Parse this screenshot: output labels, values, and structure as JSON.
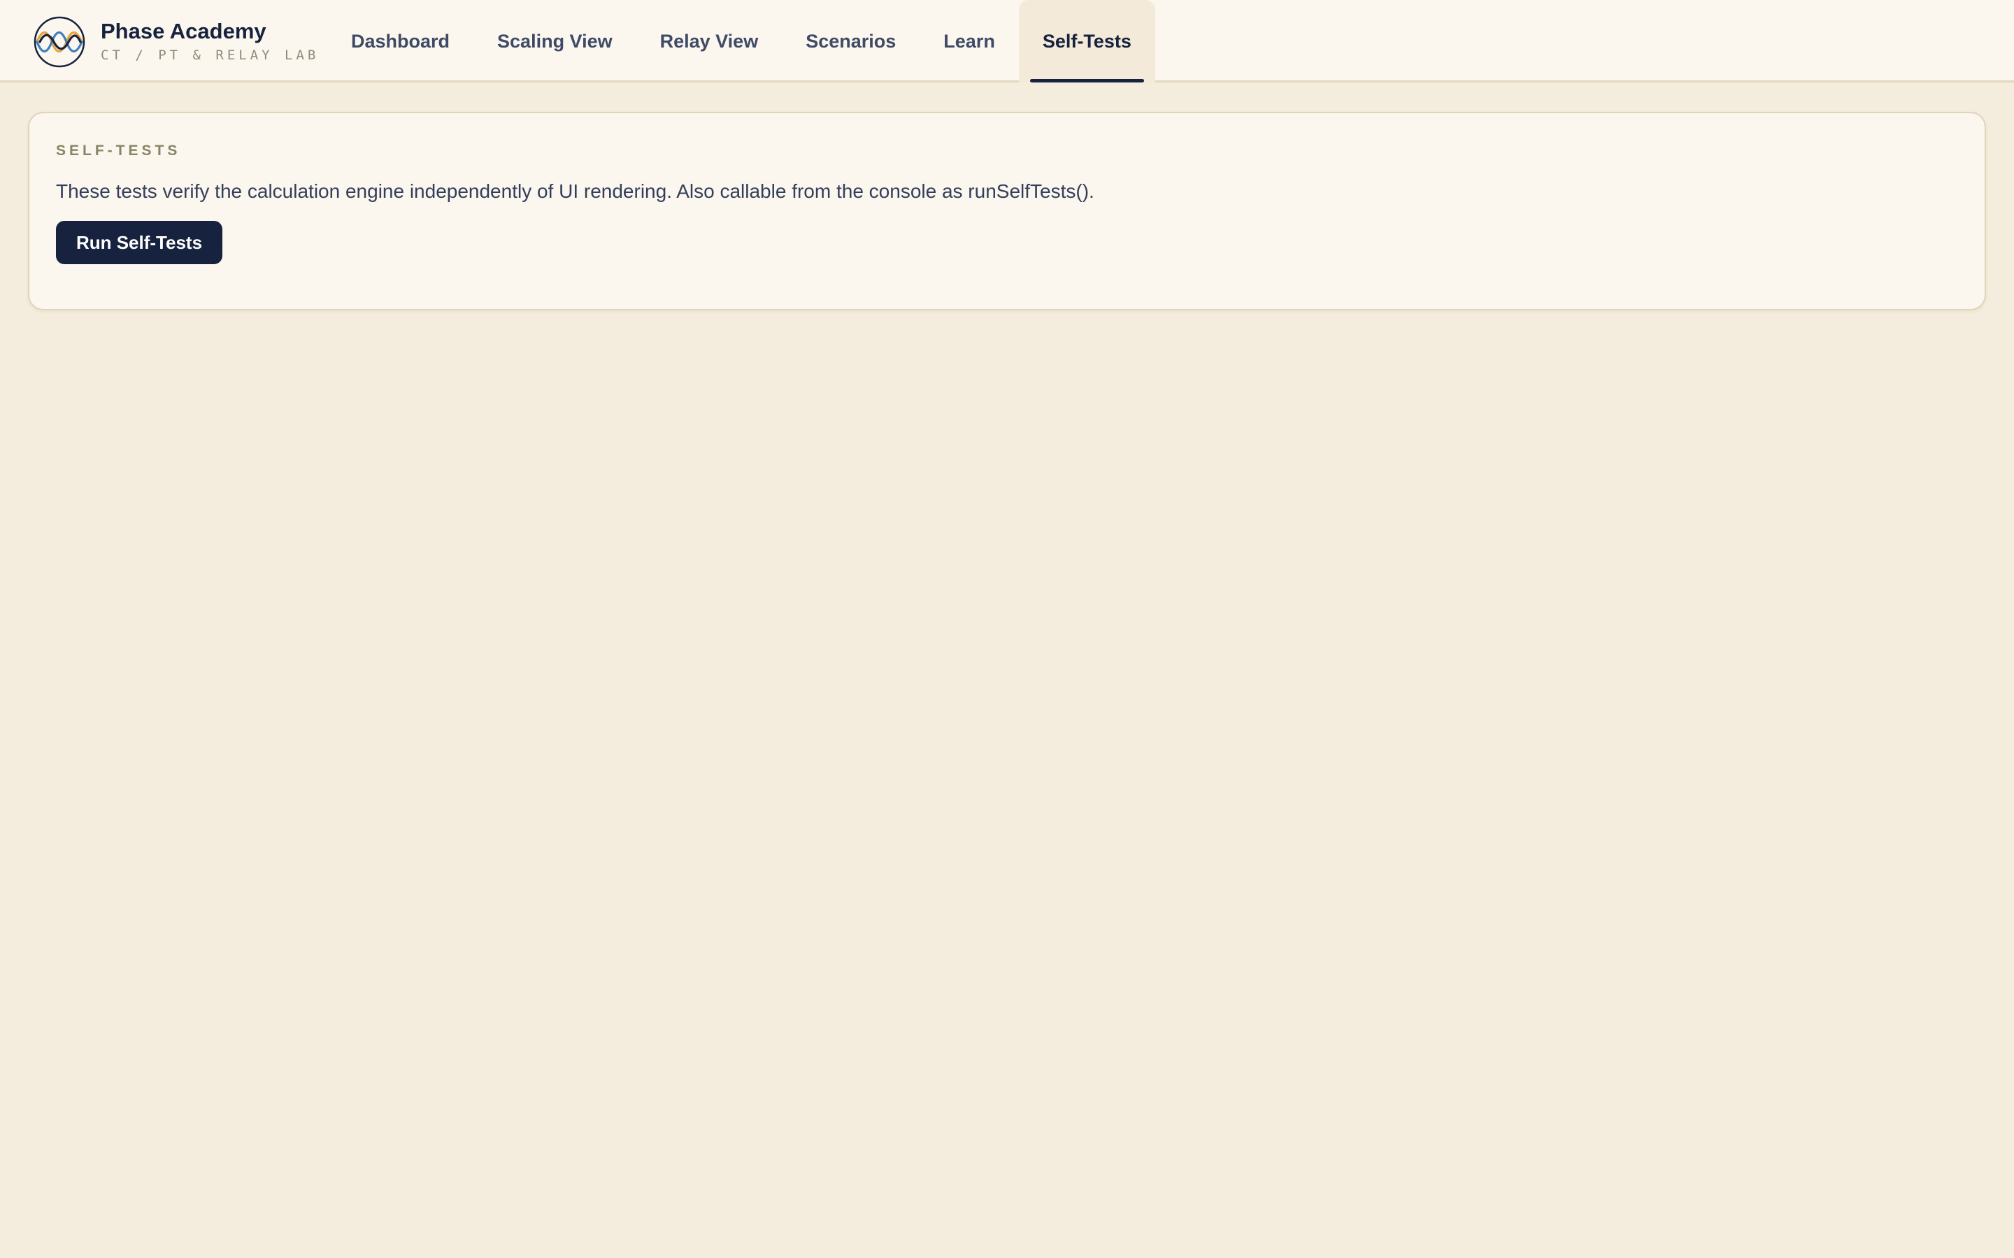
{
  "app": {
    "name": "Phase Academy",
    "subtitle": "CT / PT & RELAY LAB",
    "logo_icon": "sine-wave-logo-icon"
  },
  "nav": {
    "tabs": [
      {
        "label": "Dashboard",
        "active": false
      },
      {
        "label": "Scaling View",
        "active": false
      },
      {
        "label": "Relay View",
        "active": false
      },
      {
        "label": "Scenarios",
        "active": false
      },
      {
        "label": "Learn",
        "active": false
      },
      {
        "label": "Self-Tests",
        "active": true
      }
    ]
  },
  "self_tests": {
    "eyebrow": "SELF-TESTS",
    "description": "These tests verify the calculation engine independently of UI rendering. Also callable from the console as runSelfTests().",
    "run_button_label": "Run Self-Tests"
  },
  "colors": {
    "page_background": "#f4ecdc",
    "surface": "#fbf7ee",
    "primary_navy": "#17223f",
    "wave_orange": "#e8a33c",
    "wave_blue": "#3b7fc0",
    "wave_navy": "#17223f"
  }
}
